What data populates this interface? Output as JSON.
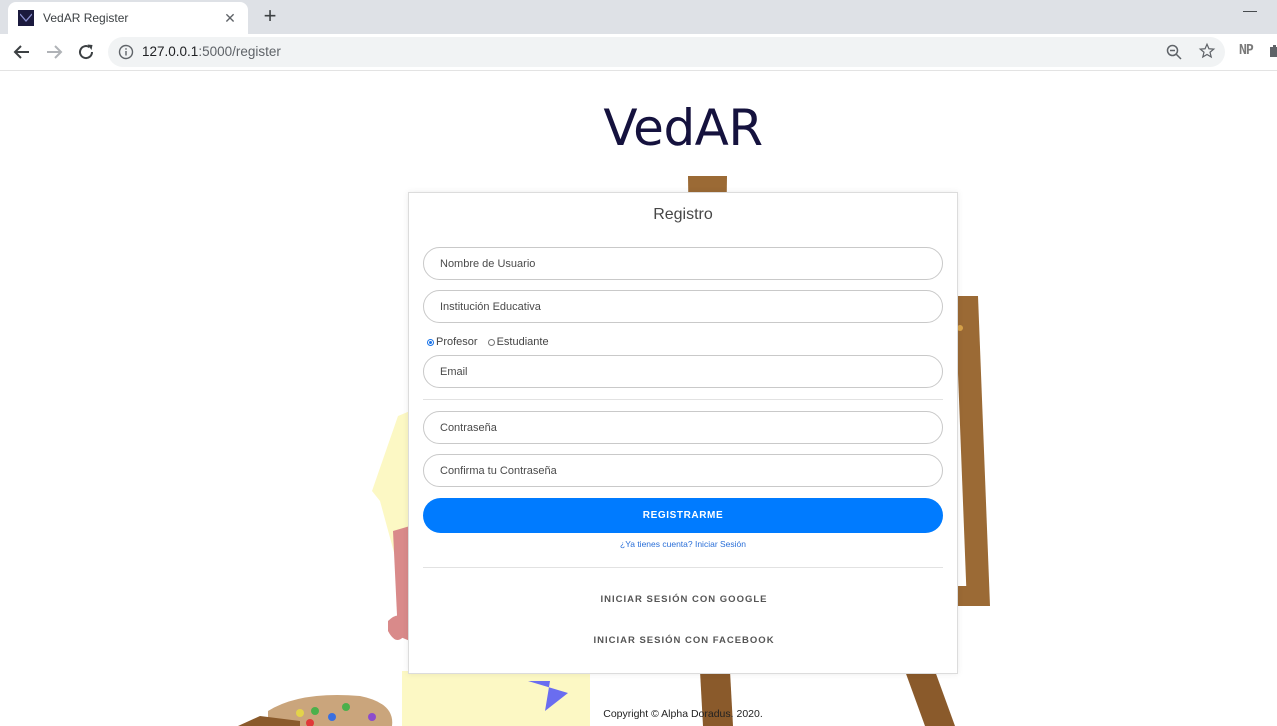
{
  "browser": {
    "tab_title": "VedAR Register",
    "tab_close": "✕",
    "new_tab": "+",
    "minimize": "—",
    "url_host": "127.0.0.1",
    "url_rest": ":5000/register",
    "extension_label": "NP"
  },
  "page": {
    "brand": "VedAR",
    "card_title": "Registro",
    "fields": {
      "username_placeholder": "Nombre de Usuario",
      "institution_placeholder": "Institución Educativa",
      "email_placeholder": "Email",
      "password_placeholder": "Contraseña",
      "confirm_placeholder": "Confirma tu Contraseña"
    },
    "role_options": [
      {
        "label": "Profesor",
        "selected": true
      },
      {
        "label": "Estudiante",
        "selected": false
      }
    ],
    "register_button": "REGISTRARME",
    "login_link": "¿Ya tienes cuenta? Iniciar Sesión",
    "google_login": "INICIAR SESIÓN CON GOOGLE",
    "facebook_login": "INICIAR SESIÓN CON FACEBOOK",
    "footer": "Copyright © Alpha Doradus. 2020."
  },
  "colors": {
    "accent": "#007bff",
    "brand_text": "#15123e",
    "link": "#2a6fd8"
  }
}
